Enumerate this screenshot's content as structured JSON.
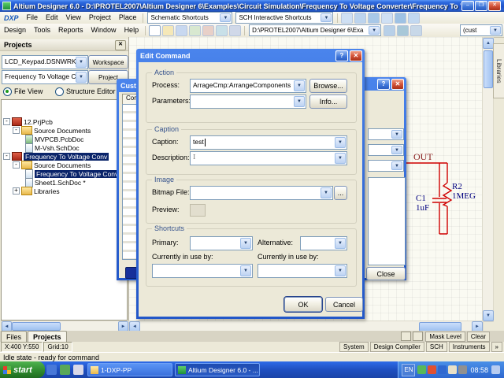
{
  "icons": {
    "close": "✕",
    "minimize": "–",
    "maximize": "❒",
    "help": "?",
    "dropdown": "▼",
    "up": "▲",
    "down": "▼",
    "left": "◄",
    "right": "►",
    "collapse": "-",
    "expand": "+",
    "ibeam": "I"
  },
  "titlebar": {
    "title": "Altium Designer 6.0 - D:\\PROTEL2007\\Altium Designer 6\\Examples\\Circuit Simulation\\Frequency To Voltage Converter\\Frequency To Voltage Conver..."
  },
  "menus": {
    "row1": [
      "DXP",
      "File",
      "Edit",
      "View",
      "Project",
      "Place"
    ],
    "row2": [
      "Design",
      "Tools",
      "Reports",
      "Window",
      "Help"
    ]
  },
  "toolbars": {
    "schematic_shortcuts": "Schematic Shortcuts",
    "sch_interactive": "SCH Interactive Shortcuts",
    "address": "D:\\PROTEL2007\\Altium Designer 6\\Exa",
    "cust": "(cust"
  },
  "projects_panel": {
    "header": "Projects",
    "workspace_combo": "LCD_Keypad.DSNWRK *",
    "workspace_button": "Workspace",
    "project_combo": "Frequency To Voltage Converter.PF",
    "project_button": "Project",
    "file_view": "File View",
    "structure_editor": "Structure Editor",
    "tree": [
      {
        "label": "12.PrjPcb",
        "level": 0,
        "selected": false
      },
      {
        "label": "Source Documents",
        "level": 1,
        "selected": false
      },
      {
        "label": "MVPCB.PcbDoc",
        "level": 2,
        "selected": false
      },
      {
        "label": "M-Vsh.SchDoc",
        "level": 2,
        "selected": false
      },
      {
        "label": "Frequency To Voltage Conv",
        "level": 0,
        "selected": true
      },
      {
        "label": "Source Documents",
        "level": 1,
        "selected": false
      },
      {
        "label": "Frequency To Voltage Conv",
        "level": 2,
        "selected": true
      },
      {
        "label": "Sheet1.SchDoc *",
        "level": 2,
        "selected": false
      },
      {
        "label": "Libraries",
        "level": 1,
        "selected": false
      }
    ]
  },
  "customizing_dialog": {
    "title": "Custo...",
    "tab": "Comm"
  },
  "edit_command_dialog": {
    "title": "Edit Command",
    "groups": {
      "action": "Action",
      "caption": "Caption",
      "image": "Image",
      "shortcuts": "Shortcuts"
    },
    "labels": {
      "process": "Process:",
      "parameters": "Parameters:",
      "caption": "Caption:",
      "description": "Description:",
      "bitmap_file": "Bitmap File:",
      "preview": "Preview:",
      "primary": "Primary:",
      "alternative": "Alternative:",
      "in_use": "Currently in use by:"
    },
    "values": {
      "process": "ArrageCmp:ArrangeComponents",
      "caption": "test"
    },
    "buttons": {
      "browse": "Browse...",
      "info": "Info...",
      "dots": "...",
      "ok": "OK",
      "cancel": "Cancel"
    }
  },
  "right_dialog": {
    "close": "Close"
  },
  "schematic": {
    "net_label": "OUT",
    "r_ref": "R2",
    "r_value": "1MEG",
    "c_ref": "C1",
    "c_value": "1uF"
  },
  "right_tab": "Libraries",
  "bottom": {
    "tabs": [
      "Files",
      "Projects"
    ],
    "mask_level": "Mask Level",
    "clear": "Clear",
    "coords": "X:400 Y:550",
    "grid": "Grid:10",
    "status": "Idle state - ready for command",
    "panels": [
      "System",
      "Design Compiler",
      "SCH",
      "Instruments"
    ],
    "more": "»"
  },
  "taskbar": {
    "start": "start",
    "tasks": [
      "1-DXP-PP",
      "Altium Designer 6.0 - ..."
    ],
    "lang": "EN",
    "time": "08:58"
  },
  "colors": {
    "selection": "#0A246A",
    "wire": "#D00000",
    "designator": "#000080",
    "net_label": "#8B2323"
  }
}
